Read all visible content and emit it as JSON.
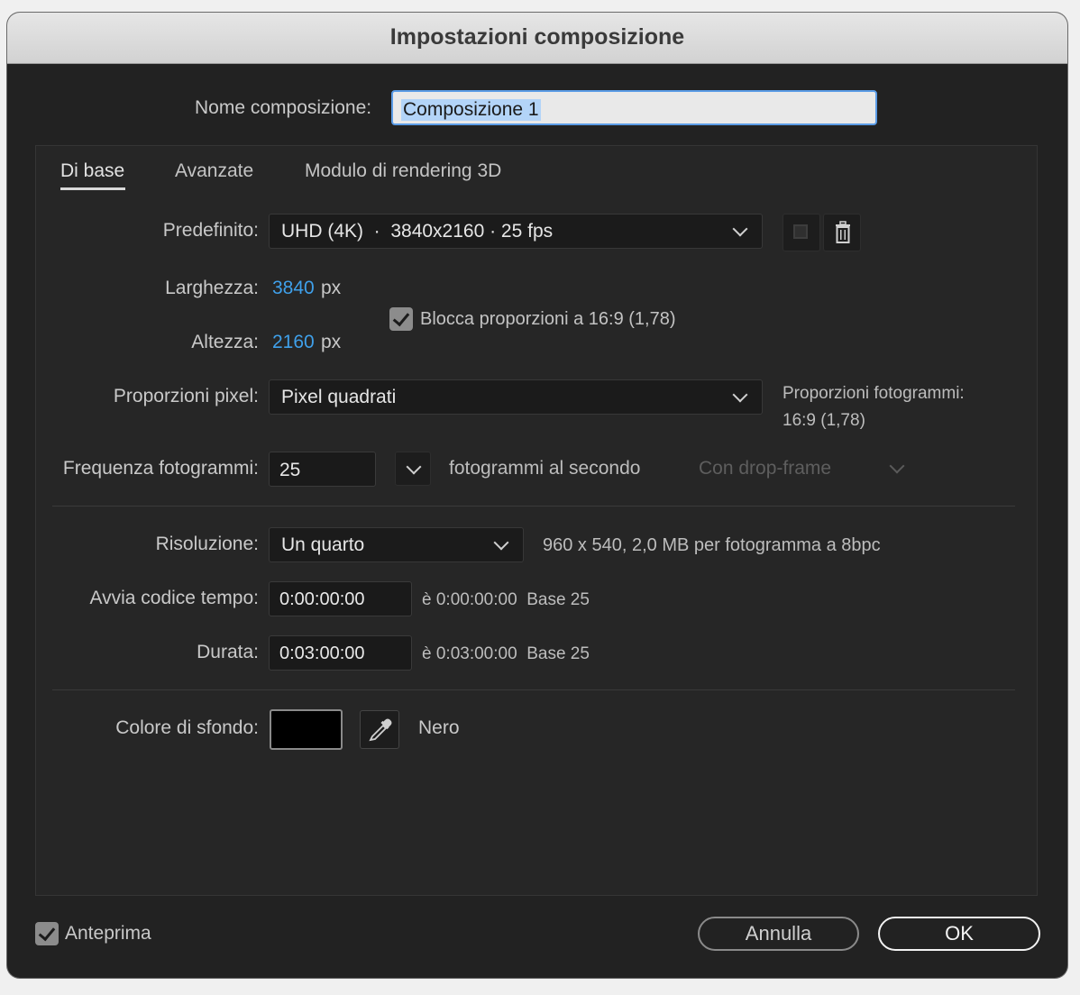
{
  "dialog": {
    "title": "Impostazioni composizione"
  },
  "name_row": {
    "label": "Nome composizione:",
    "value": "Composizione 1"
  },
  "tabs": [
    {
      "label": "Di base",
      "active": true
    },
    {
      "label": "Avanzate",
      "active": false
    },
    {
      "label": "Modulo di rendering 3D",
      "active": false
    }
  ],
  "preset": {
    "label": "Predefinito:",
    "value": "UHD (4K)  ·  3840x2160 · 25 fps"
  },
  "width": {
    "label": "Larghezza:",
    "value": "3840",
    "unit": "px"
  },
  "height": {
    "label": "Altezza:",
    "value": "2160",
    "unit": "px"
  },
  "lock_aspect": {
    "label": "Blocca proporzioni a 16:9 (1,78)",
    "checked": true
  },
  "pixel_aspect": {
    "label": "Proporzioni pixel:",
    "value": "Pixel quadrati"
  },
  "frame_aspect": {
    "title": "Proporzioni fotogrammi:",
    "value": "16:9 (1,78)"
  },
  "frame_rate": {
    "label": "Frequenza fotogrammi:",
    "value": "25",
    "unit": "fotogrammi al secondo",
    "drop_frame": "Con drop-frame"
  },
  "resolution": {
    "label": "Risoluzione:",
    "value": "Un quarto",
    "info": "960 x 540, 2,0 MB per fotogramma a 8bpc"
  },
  "start_timecode": {
    "label": "Avvia codice tempo:",
    "value": "0:00:00:00",
    "info": "è 0:00:00:00  Base 25"
  },
  "duration": {
    "label": "Durata:",
    "value": "0:03:00:00",
    "info": "è 0:03:00:00  Base 25"
  },
  "background": {
    "label": "Colore di sfondo:",
    "color_name": "Nero",
    "color": "#000000"
  },
  "footer": {
    "preview_label": "Anteprima",
    "preview_checked": true,
    "cancel_label": "Annulla",
    "ok_label": "OK"
  },
  "colors": {
    "accent": "#3fa0ea",
    "dialog_bg": "#222222"
  }
}
